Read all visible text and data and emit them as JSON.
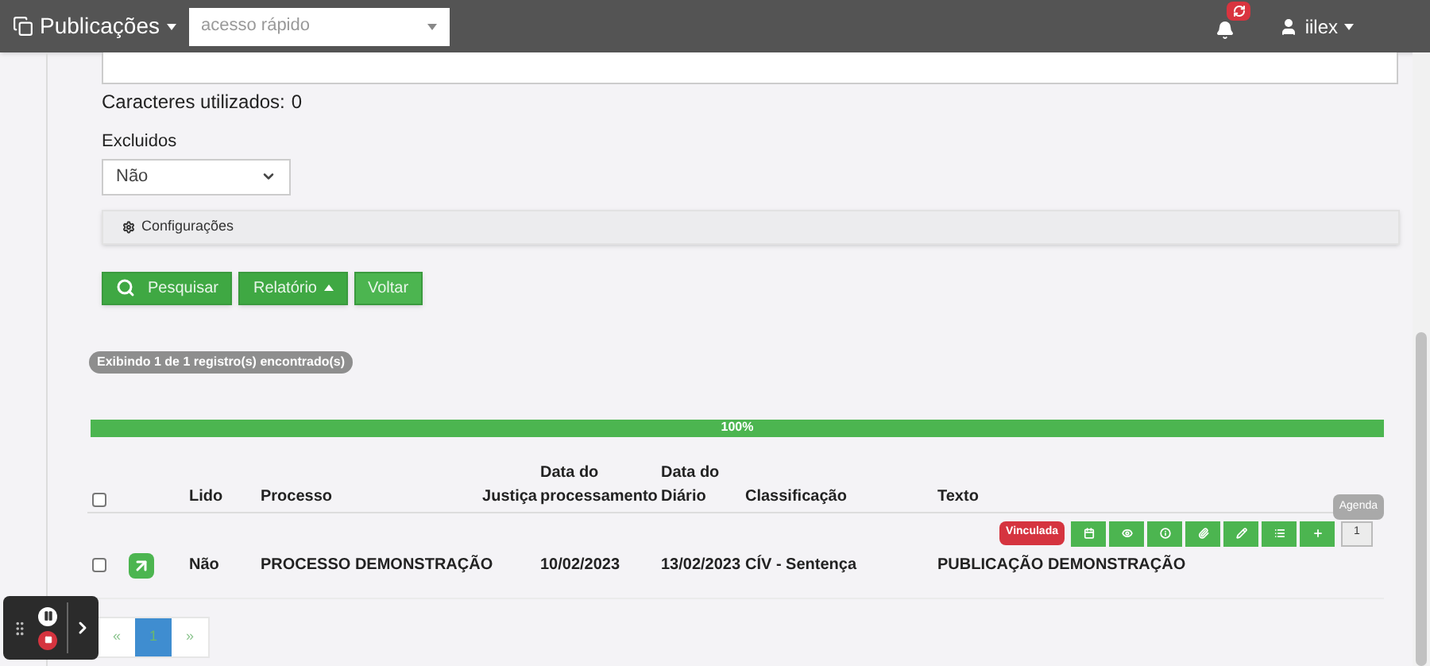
{
  "navbar": {
    "brand": "Publicações",
    "quick_access": {
      "placeholder": "acesso rápido"
    },
    "user": "iilex"
  },
  "form": {
    "chars_label": "Caracteres utilizados:",
    "chars_count": "0",
    "excluded_label": "Excluidos",
    "excluded_value": "Não",
    "settings_panel": "Configurações"
  },
  "buttons": [
    {
      "label": "Pesquisar",
      "kind": "search"
    },
    {
      "label": "Relatório",
      "kind": "dropdown"
    },
    {
      "label": "Voltar",
      "kind": "plain"
    }
  ],
  "results_badge": "Exibindo 1 de 1 registro(s) encontrado(s)",
  "progress": {
    "level": 1,
    "label": "100%"
  },
  "table": {
    "columns": [
      "Lido",
      "Processo",
      "Justiça",
      "Data do processamento",
      "Data do Diário",
      "Classificação",
      "Texto"
    ],
    "header_checked": false,
    "rows": [
      {
        "checked": false,
        "status_badge": "Vinculada",
        "agenda_count": "1",
        "tooltip": "Agenda",
        "lido": "Não",
        "processo": "PROCESSO DEMONSTRAÇÃO",
        "justica": "",
        "data_processamento": "10/02/2023",
        "data_diario": "13/02/2023",
        "classificacao": "CÍV - Sentença",
        "texto": "PUBLICAÇÃO DEMONSTRAÇÃO"
      }
    ]
  },
  "pagination": [
    {
      "label": "«",
      "selected": false
    },
    {
      "label": "1",
      "selected": true
    },
    {
      "label": "»",
      "selected": false
    }
  ]
}
